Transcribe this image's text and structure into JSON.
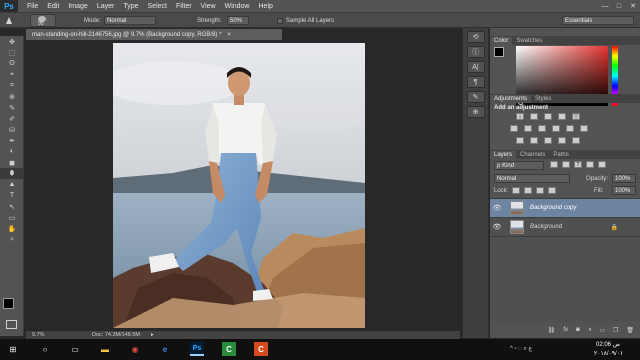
{
  "app": {
    "logo": "Ps",
    "doc_tab": "man-standing-on-hill-2146756.jpg @ 9.7% (Background copy, RGB/8) *",
    "doc_tab_close": "×"
  },
  "menu": [
    "File",
    "Edit",
    "Image",
    "Layer",
    "Type",
    "Select",
    "Filter",
    "View",
    "Window",
    "Help"
  ],
  "window_controls": {
    "minimize": "—",
    "maximize": "□",
    "close": "✕"
  },
  "options": {
    "brush_size": "90",
    "mode_label": "Mode:",
    "mode_value": "Normal",
    "strength_label": "Strength:",
    "strength_value": "50%",
    "sample_all_layers": "Sample All Layers",
    "workspace": "Essentials"
  },
  "tools": [
    "✥",
    "⬚",
    "ʘ",
    "⌖",
    "⌗",
    "⊕",
    "✎",
    "✐",
    "⛁",
    "✒",
    "◐",
    "◼",
    "⬮",
    "▲",
    "T",
    "↖",
    "▭",
    "✋",
    "⌕"
  ],
  "status": {
    "zoom": "9.7%",
    "doc": "Doc: 74.3M/148.5M",
    "arrow": "▸"
  },
  "dock": {
    "history": "⟲",
    "info": "ⓘ",
    "char": "A|",
    "para": "¶",
    "brush": "✎",
    "clone": "⊕"
  },
  "color_panel": {
    "tab_active": "Color",
    "tab_other": "Swatches",
    "accent": "#e3342f"
  },
  "adjustments": {
    "tab_active": "Adjustments",
    "tab_other": "Styles",
    "title": "Add an adjustment"
  },
  "layers_panel": {
    "tabs": [
      "Layers",
      "Channels",
      "Paths"
    ],
    "kind": "ρ Kind",
    "blend_mode": "Normal",
    "opacity_label": "Opacity:",
    "opacity_value": "100%",
    "lock_label": "Lock:",
    "fill_label": "Fill:",
    "fill_value": "100%",
    "layers": [
      {
        "name": "Background copy",
        "selected": true,
        "locked": false
      },
      {
        "name": "Background",
        "selected": false,
        "locked": true
      }
    ],
    "footer_icons": [
      "⛓",
      "fx",
      "◙",
      "◑",
      "▭",
      "❐",
      "🗑"
    ]
  },
  "taskbar": {
    "start": "⊞",
    "search": "○",
    "taskview": "▭",
    "explorer": "▬",
    "chrome": "◉",
    "edge": "e",
    "ps": "Ps",
    "camtasia": "C",
    "camtasia2": "C",
    "tray": "^ ▫ ◌ ⌕ ع",
    "time": "02:06 ص",
    "date": "٢٠١٨/٠٩/٠١"
  }
}
